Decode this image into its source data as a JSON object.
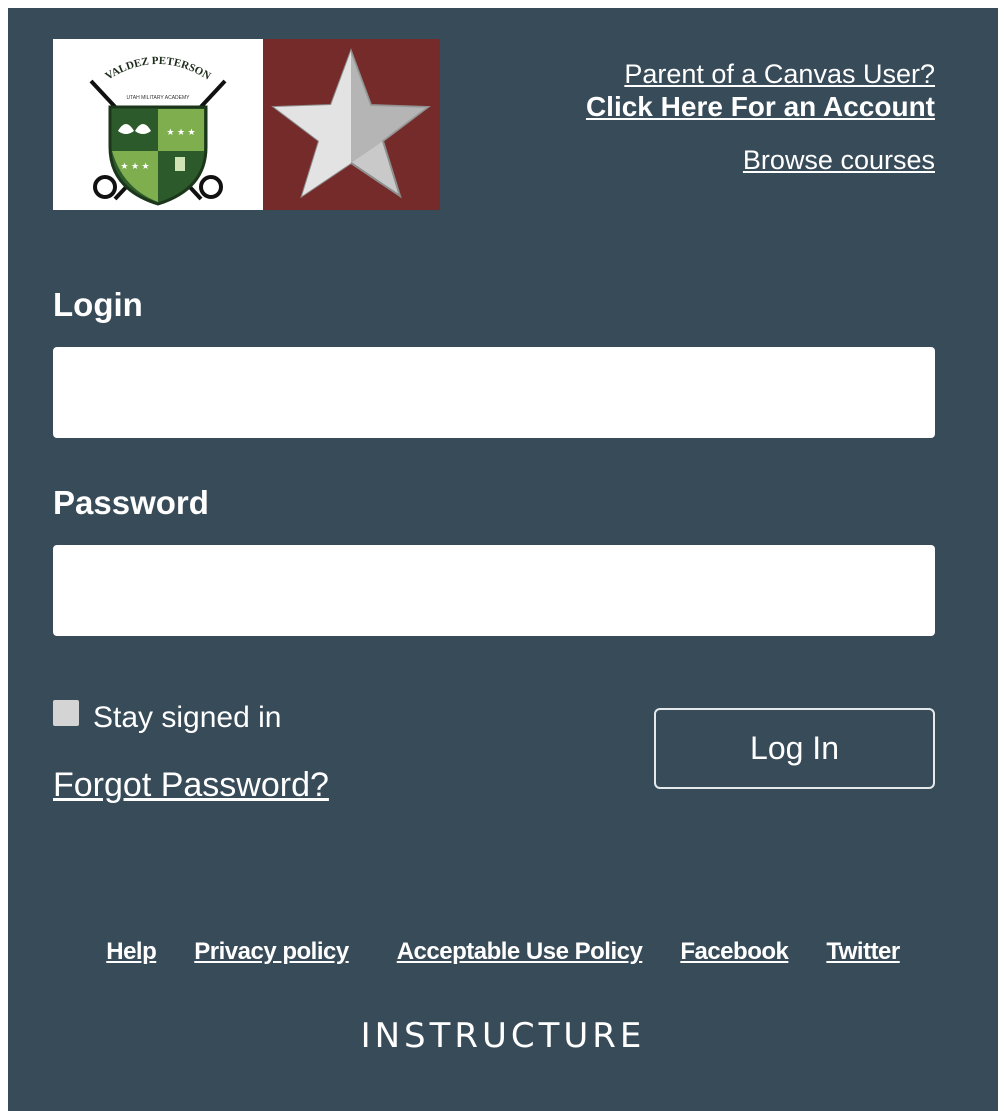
{
  "logo": {
    "school_name": "VALDEZ PETERSON",
    "school_subtitle": "UTAH MILITARY ACADEMY",
    "shield_marks": [
      "★ ★ ★",
      "★ ★ ★"
    ],
    "colors": {
      "shield_dark": "#2c5a2a",
      "shield_light": "#7fae4f",
      "star_bg": "#742b29",
      "star": "#c9c9c9"
    }
  },
  "top_links": {
    "parent": "Parent of a Canvas User?",
    "account": "Click Here For an Account",
    "browse": "Browse courses"
  },
  "form": {
    "login_label": "Login",
    "login_value": "",
    "password_label": "Password",
    "password_value": "",
    "stay_signed_in_label": "Stay signed in",
    "stay_signed_in_checked": false,
    "forgot_password": "Forgot Password?",
    "submit_label": "Log In"
  },
  "footer": {
    "links": [
      "Help",
      "Privacy policy",
      "Acceptable Use Policy",
      "Facebook",
      "Twitter"
    ],
    "brand": "INSTRUCTURE"
  },
  "colors": {
    "panel_bg": "#384b59",
    "text": "#ffffff",
    "input_bg": "#ffffff",
    "button_border": "#e6e9eb"
  }
}
